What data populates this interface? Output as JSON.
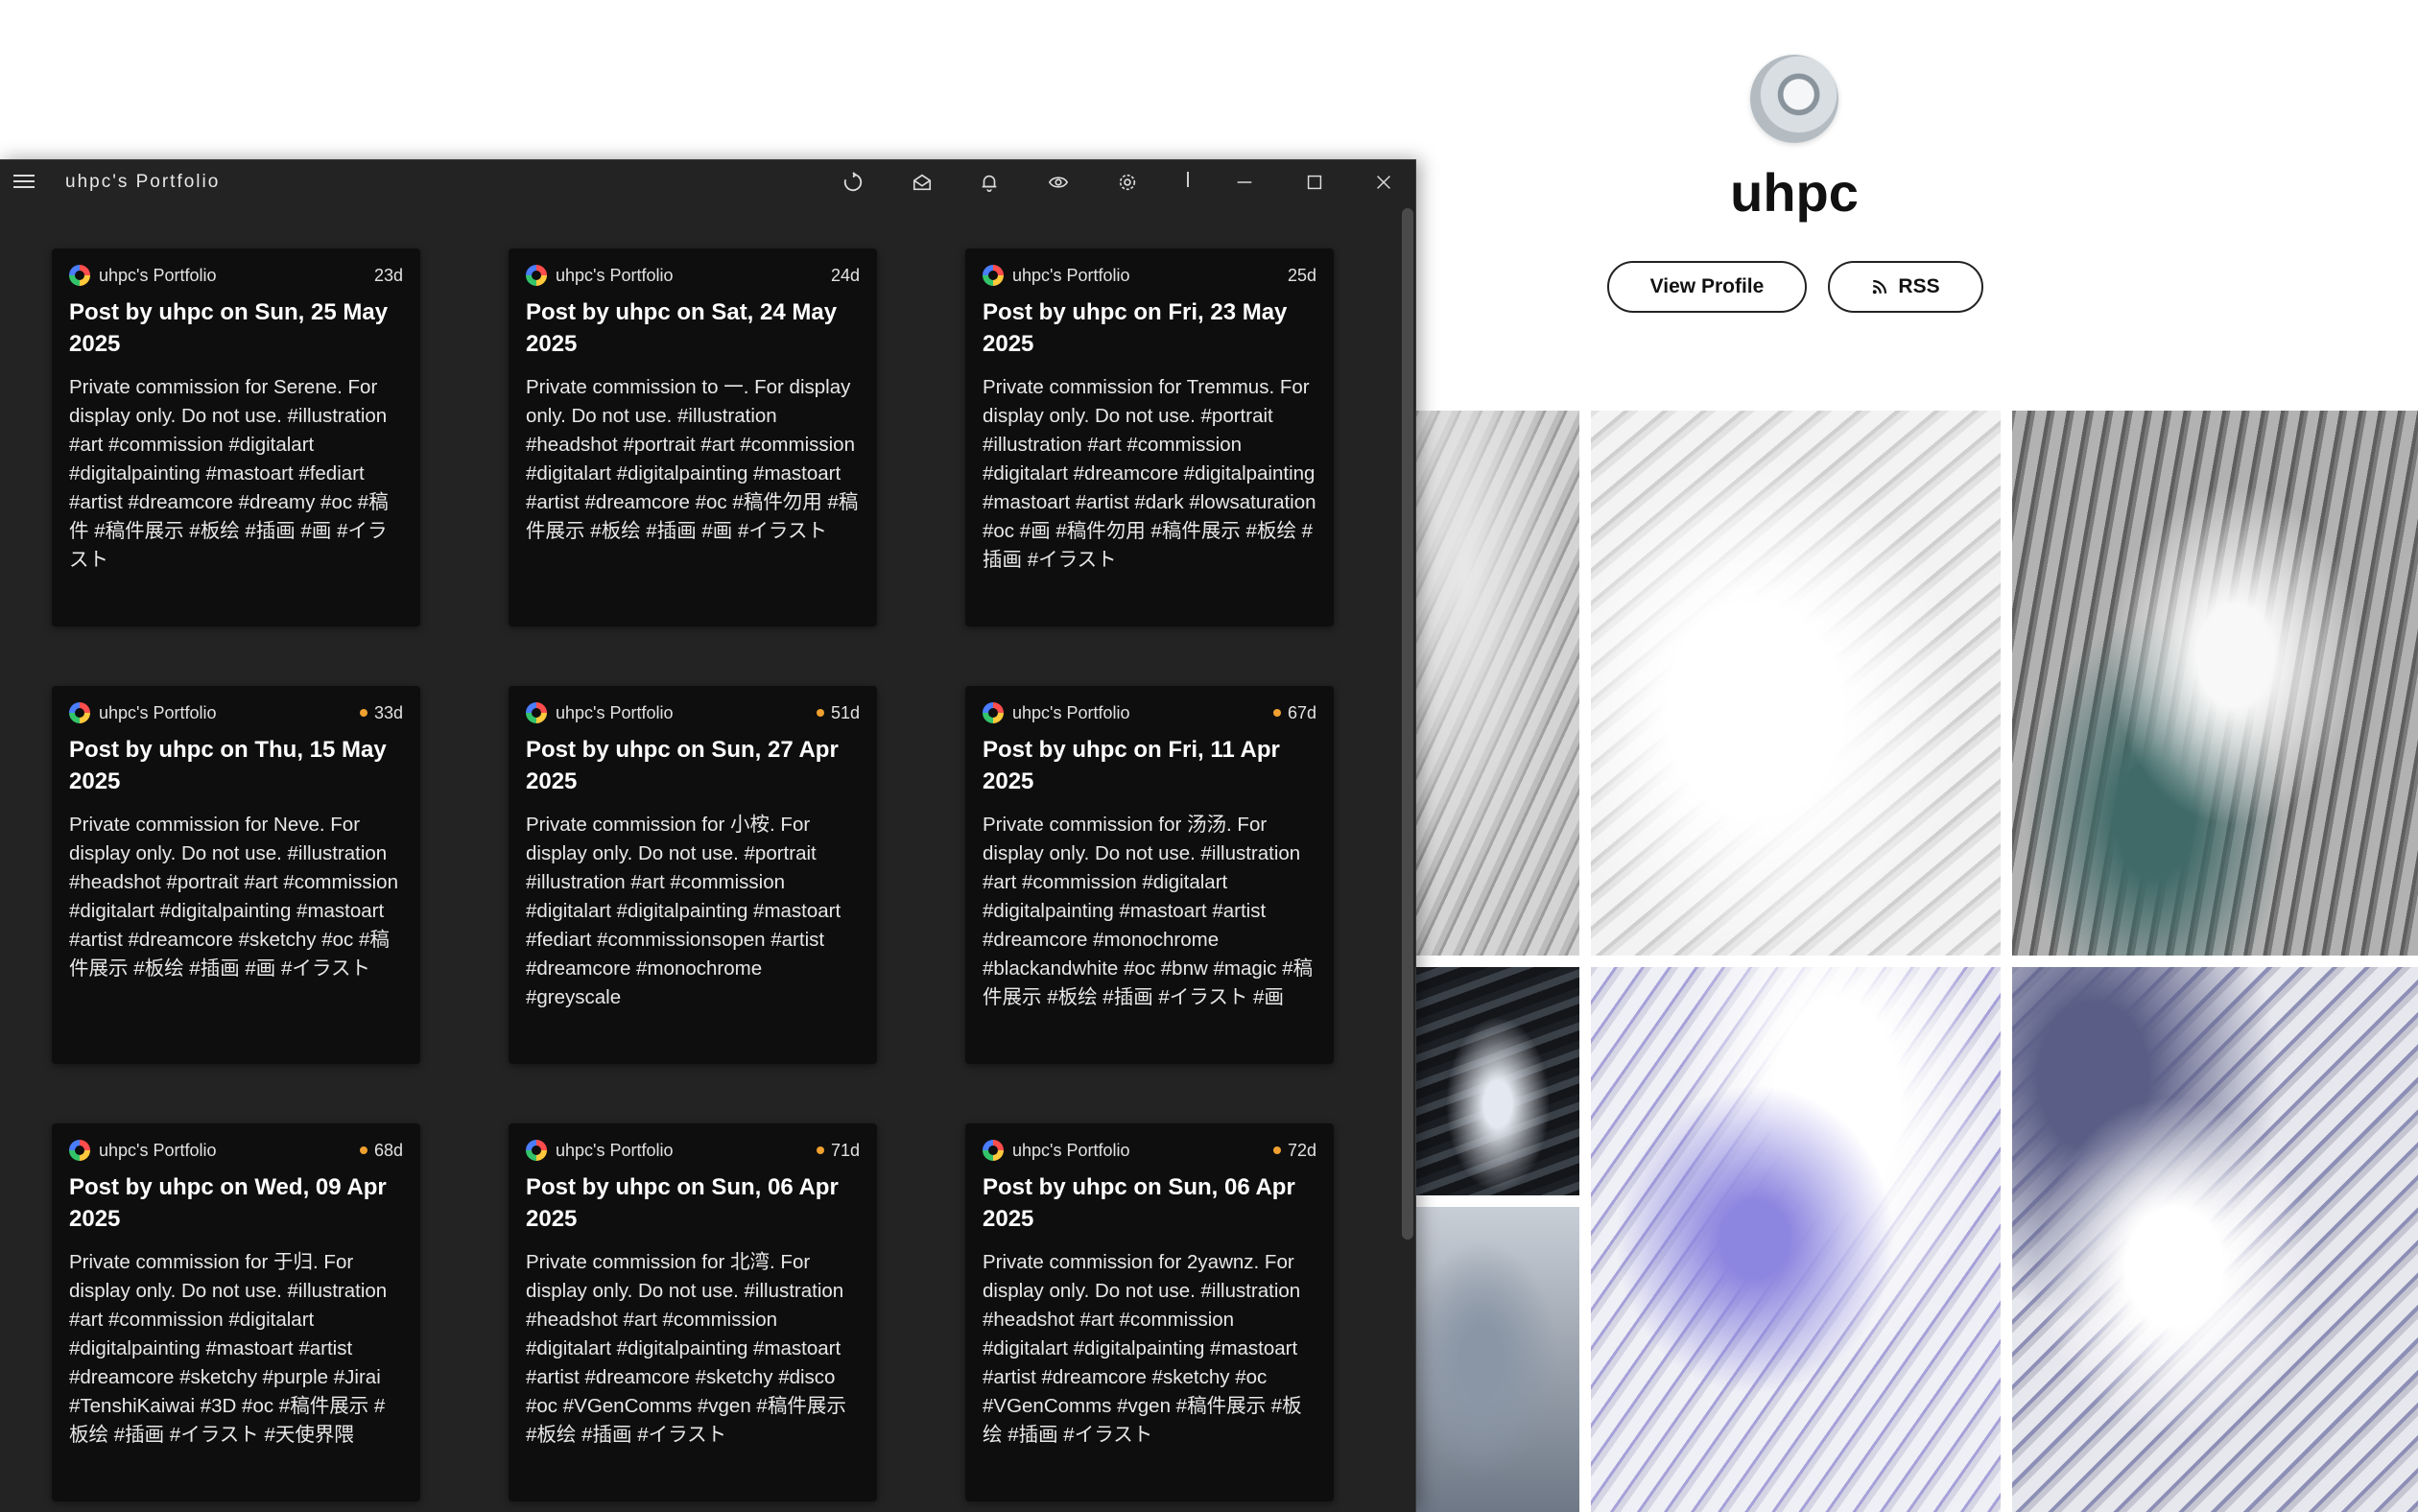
{
  "profile": {
    "name": "uhpc",
    "view_profile_label": "View Profile",
    "rss_label": "RSS"
  },
  "window": {
    "title": "uhpc's Portfolio"
  },
  "cards": [
    {
      "source": "uhpc's Portfolio",
      "age": "23d",
      "unread": false,
      "title": "Post by uhpc on Sun, 25 May 2025",
      "body": "Private commission for Serene. For display only. Do not use. #illustration #art #commission #digitalart #digitalpainting #mastoart #fediart #artist #dreamcore #dreamy #oc #稿件 #稿件展示 #板绘 #插画 #画 #イラスト"
    },
    {
      "source": "uhpc's Portfolio",
      "age": "24d",
      "unread": false,
      "title": "Post by uhpc on Sat, 24 May 2025",
      "body": "Private commission to 一. For display only. Do not use. #illustration #headshot #portrait #art #commission #digitalart #digitalpainting #mastoart #artist #dreamcore #oc #稿件勿用 #稿件展示 #板绘 #插画 #画 #イラスト"
    },
    {
      "source": "uhpc's Portfolio",
      "age": "25d",
      "unread": false,
      "title": "Post by uhpc on Fri, 23 May 2025",
      "body": "Private commission for Tremmus. For display only. Do not use. #portrait #illustration #art #commission #digitalart #dreamcore #digitalpainting #mastoart #artist #dark #lowsaturation #oc #画 #稿件勿用 #稿件展示 #板绘 #插画 #イラスト"
    },
    {
      "source": "uhpc's Portfolio",
      "age": "33d",
      "unread": true,
      "title": "Post by uhpc on Thu, 15 May 2025",
      "body": "Private commission for Neve. For display only. Do not use. #illustration #headshot #portrait #art #commission #digitalart #digitalpainting #mastoart #artist #dreamcore #sketchy #oc #稿件展示 #板绘 #插画 #画 #イラスト"
    },
    {
      "source": "uhpc's Portfolio",
      "age": "51d",
      "unread": true,
      "title": "Post by uhpc on Sun, 27 Apr 2025",
      "body": "Private commission for 小桉. For display only. Do not use. #portrait #illustration #art #commission #digitalart #digitalpainting #mastoart #fediart #commissionsopen #artist #dreamcore #monochrome #greyscale"
    },
    {
      "source": "uhpc's Portfolio",
      "age": "67d",
      "unread": true,
      "title": "Post by uhpc on Fri, 11 Apr 2025",
      "body": "Private commission for 汤汤. For display only. Do not use. #illustration #art #commission #digitalart #digitalpainting #mastoart #artist #dreamcore #monochrome #blackandwhite #oc #bnw #magic #稿件展示 #板绘 #插画 #イラスト #画"
    },
    {
      "source": "uhpc's Portfolio",
      "age": "68d",
      "unread": true,
      "title": "Post by uhpc on Wed, 09 Apr 2025",
      "body": "Private commission for 于归. For display only. Do not use. #illustration #art #commission #digitalart #digitalpainting #mastoart #artist #dreamcore #sketchy #purple #Jirai #TenshiKaiwai #3D #oc #稿件展示 #板绘 #插画 #イラスト #天使界隈"
    },
    {
      "source": "uhpc's Portfolio",
      "age": "71d",
      "unread": true,
      "title": "Post by uhpc on Sun, 06 Apr 2025",
      "body": "Private commission for 北湾. For display only. Do not use. #illustration #headshot #art #commission #digitalart #digitalpainting #mastoart #artist #dreamcore #sketchy #disco #oc #VGenComms #vgen #稿件展示 #板绘 #插画 #イラスト"
    },
    {
      "source": "uhpc's Portfolio",
      "age": "72d",
      "unread": true,
      "title": "Post by uhpc on Sun, 06 Apr 2025",
      "body": "Private commission for 2yawnz. For display only. Do not use. #illustration #headshot #art #commission #digitalart #digitalpainting #mastoart #artist #dreamcore #sketchy #oc #VGenComms #vgen #稿件展示 #板绘 #插画 #イラスト"
    }
  ]
}
